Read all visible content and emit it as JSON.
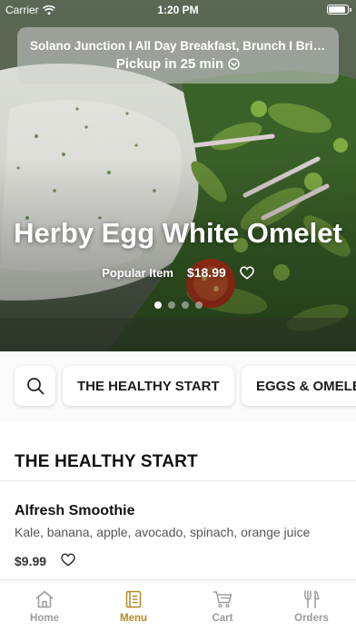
{
  "status_bar": {
    "carrier": "Carrier",
    "time": "1:20 PM"
  },
  "store": {
    "name": "Solano Junction I All Day Breakfast, Brunch I Brin...",
    "pickup": "Pickup in 25 min"
  },
  "featured": {
    "title": "Herby Egg White Omelet",
    "badge": "Popular Item",
    "price": "$18.99",
    "pages": 4,
    "active_page": 0
  },
  "categories": [
    "THE HEALTHY START",
    "EGGS & OMELETTES"
  ],
  "section": {
    "title": "THE HEALTHY START"
  },
  "items": [
    {
      "name": "Alfresh Smoothie",
      "description": "Kale, banana, apple, avocado, spinach, orange juice",
      "price": "$9.99"
    }
  ],
  "tabs": [
    {
      "label": "Home",
      "icon": "home-icon"
    },
    {
      "label": "Menu",
      "icon": "menu-book-icon",
      "active": true
    },
    {
      "label": "Cart",
      "icon": "cart-icon"
    },
    {
      "label": "Orders",
      "icon": "fork-knife-icon"
    }
  ],
  "colors": {
    "accent": "#b48a22",
    "tab_inactive": "#9b9b9b"
  }
}
